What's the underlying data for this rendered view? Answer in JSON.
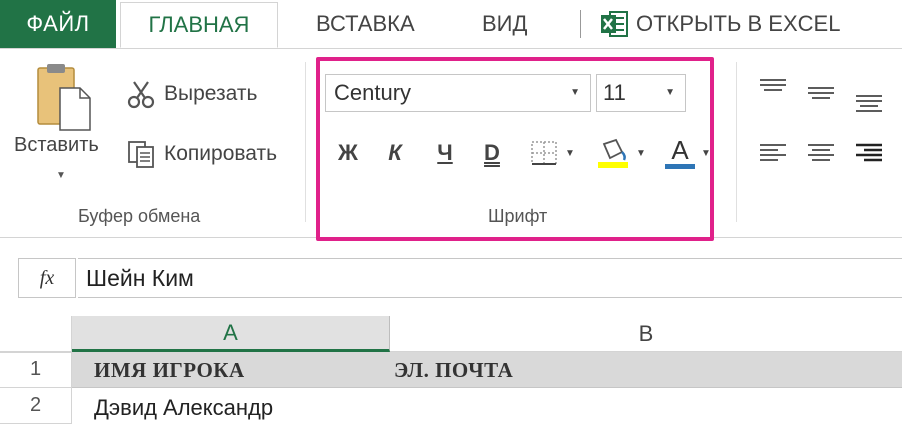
{
  "tabs": {
    "file": "ФАЙЛ",
    "home": "ГЛАВНАЯ",
    "insert": "ВСТАВКА",
    "view": "ВИД",
    "open_in_excel": "ОТКРЫТЬ В EXCEL"
  },
  "clipboard": {
    "paste_label": "Вставить",
    "cut_label": "Вырезать",
    "copy_label": "Копировать",
    "group_label": "Буфер обмена"
  },
  "font": {
    "font_name": "Century",
    "font_size": "11",
    "bold_label": "Ж",
    "italic_label": "К",
    "underline_label": "Ч",
    "double_underline_label": "D",
    "font_color_label": "A",
    "group_label": "Шрифт"
  },
  "formula_bar": {
    "fx_label": "fx",
    "value": "Шейн Ким"
  },
  "grid": {
    "columns": [
      "A",
      "B"
    ],
    "rows": [
      {
        "num": "1",
        "a": "ИМЯ ИГРОКА",
        "b": "ЭЛ. ПОЧТА"
      },
      {
        "num": "2",
        "a": "Дэвид Александр",
        "b": ""
      }
    ]
  },
  "colors": {
    "accent": "#217346",
    "highlight_border": "#e0218a",
    "fill_color": "#ffff00",
    "font_color_bar": "#2e75b6"
  }
}
